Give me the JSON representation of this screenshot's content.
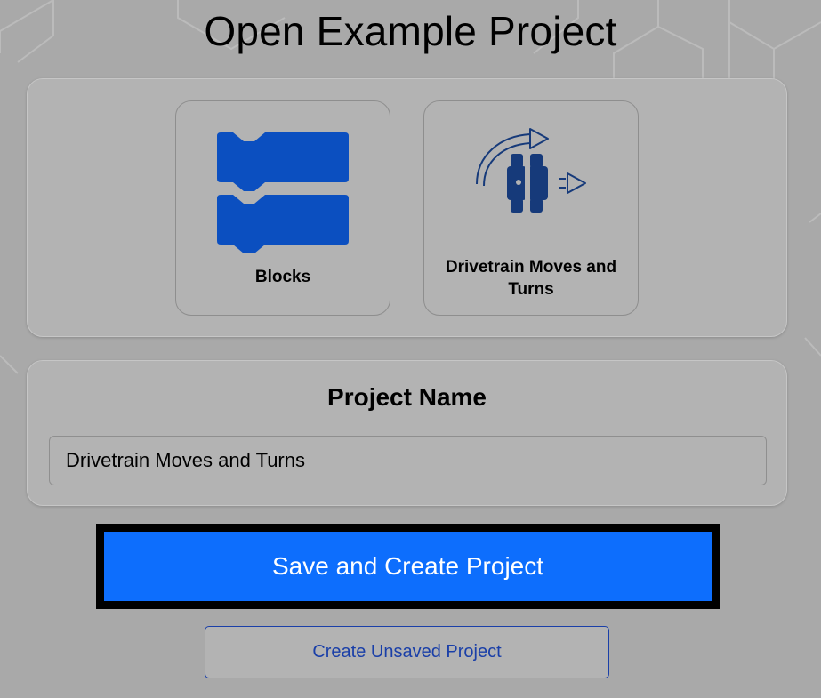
{
  "page": {
    "title": "Open Example Project"
  },
  "examples": [
    {
      "label": "Blocks",
      "icon": "blocks-icon"
    },
    {
      "label": "Drivetrain Moves and Turns",
      "icon": "drivetrain-turn-icon"
    }
  ],
  "project_name": {
    "heading": "Project Name",
    "value": "Drivetrain Moves and Turns"
  },
  "actions": {
    "save_label": "Save and Create Project",
    "unsaved_label": "Create Unsaved Project"
  },
  "colors": {
    "primary": "#0d6efd",
    "icon_blue": "#0b4fc0",
    "icon_navy": "#163a7a",
    "link_blue": "#1a3fa8",
    "overlay": "#a9a9a9"
  }
}
